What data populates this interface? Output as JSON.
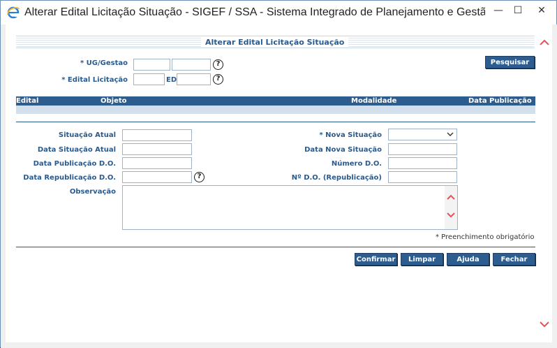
{
  "window": {
    "title": "Alterar Edital Licitação Situação - SIGEF / SSA - Sistema Integrado de Planejamento e Gestão Fi - W...",
    "minimize": "—",
    "maximize": "☐",
    "close": "✕"
  },
  "colors": {
    "accent": "#2d5c8f",
    "label": "#2b5a8c",
    "grid_row": "#d3e0ec",
    "scroll_arrow": "#e5545a"
  },
  "form": {
    "title": "Alterar Edital Licitação Situação",
    "ug_gestao_label": "* UG/Gestao",
    "edital_label": "* Edital Licitação",
    "ed_label": "ED",
    "help_glyph": "?",
    "search_button": "Pesquisar"
  },
  "grid": {
    "columns": [
      "Edital",
      "Objeto",
      "Modalidade",
      "Data Publicação"
    ]
  },
  "details": {
    "situacao_atual_label": "Situação Atual",
    "data_situacao_atual_label": "Data Situação Atual",
    "data_publicacao_label": "Data Publicação D.O.",
    "data_republicacao_label": "Data Republicação D.O.",
    "observacao_label": "Observação",
    "nova_situacao_label": "* Nova Situação",
    "data_nova_situacao_label": "Data Nova Situação",
    "numero_do_label": "Número D.O.",
    "numero_republicacao_label": "Nº D.O. (Republicação)",
    "required_note": "* Preenchimento obrigatório"
  },
  "actions": {
    "confirm": "Confirmar",
    "clear": "Limpar",
    "help": "Ajuda",
    "close": "Fechar"
  },
  "icons": {
    "browser": "ie-icon",
    "help": "help-circle-icon",
    "dropdown": "chevron-down-icon",
    "scroll_up": "chevron-up-icon",
    "scroll_down": "chevron-down-icon"
  }
}
